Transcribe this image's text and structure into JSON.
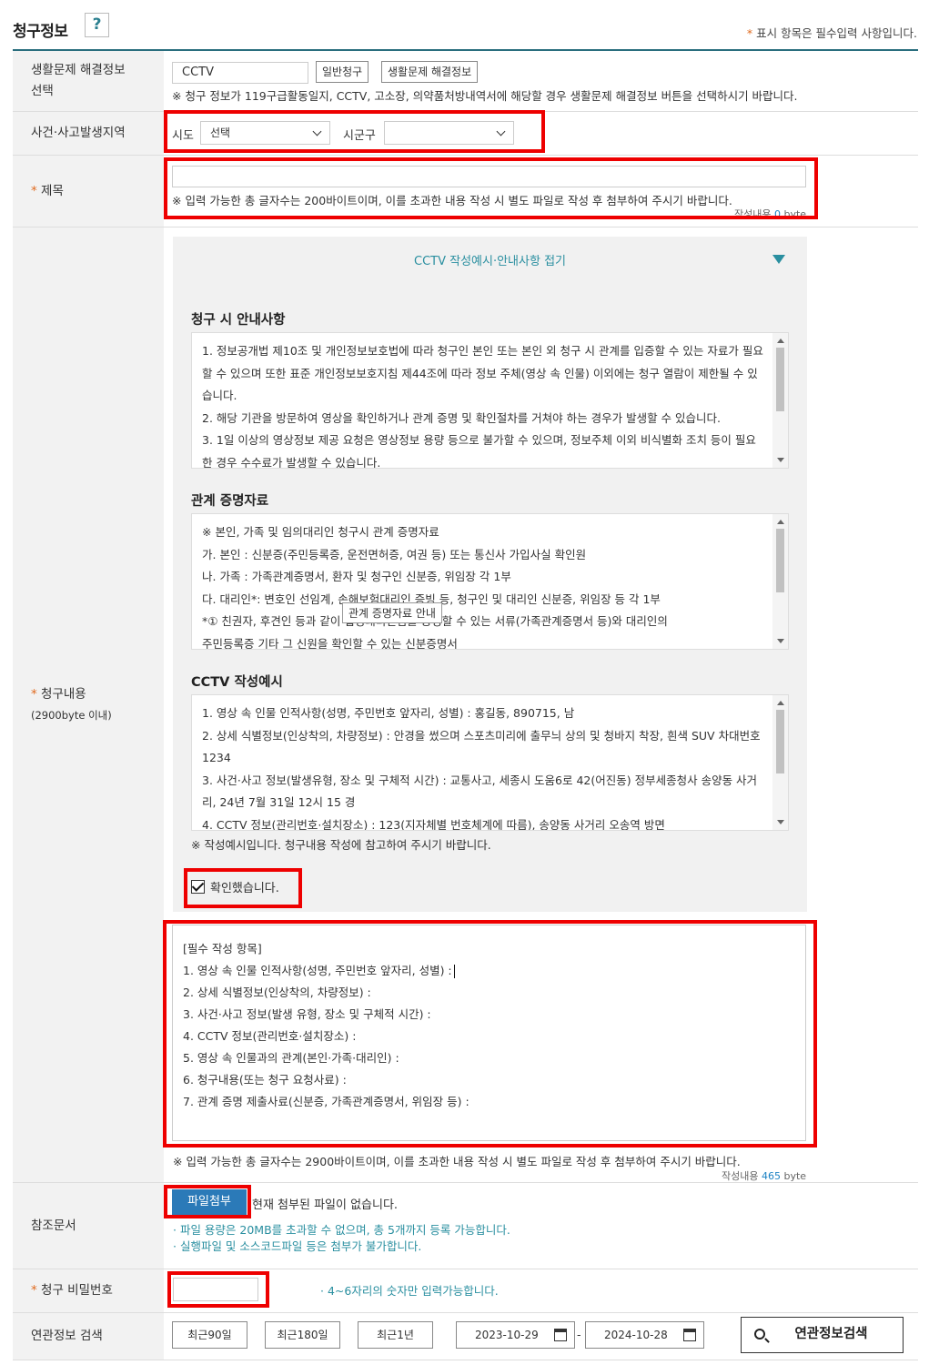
{
  "header": {
    "title": "청구정보",
    "help_label": "?",
    "required_note_star": "*",
    "required_note": " 표시 항목은 필수입력 사항입니다."
  },
  "solution_row": {
    "label_line1": "생활문제 해결정보",
    "label_line2": "선택",
    "value": "CCTV",
    "btn_general": "일반청구",
    "btn_solution": "생활문제 해결정보",
    "note": "※ 청구 정보가 119구급활동일지, CCTV, 고소장, 의약품처방내역서에 해당할 경우 생활문제 해결정보 버튼을 선택하시기 바랍니다."
  },
  "region_row": {
    "label": "사건·사고발생지역",
    "sido_label": "시도",
    "sido_value": "선택",
    "sigungu_label": "시군구",
    "sigungu_value": ""
  },
  "title_row": {
    "star": "*",
    "label": "제목",
    "value": "",
    "note": "※ 입력 가능한 총 글자수는 200바이트이며, 이를 초과한 내용 작성 시 별도 파일로 작성 후 첨부하여 주시기 바랍니다.",
    "count_prefix": "작성내용",
    "count": "0",
    "count_unit": "byte"
  },
  "content_row": {
    "star": "*",
    "label_line1": "청구내용",
    "label_line2": "(2900byte 이내)",
    "guide_toggle": "CCTV 작성예시·안내사항 접기",
    "notice_title": "청구 시 안내사항",
    "notice_lines": [
      "1. 정보공개법 제10조 및 개인정보보호법에 따라 청구인 본인 또는 본인 외 청구 시 관계를 입증할 수 있는 자료가 필요",
      "할 수 있으며 또한 표준 개인정보보호지침 제44조에 따라 정보 주체(영상 속 인물) 이외에는 청구 열람이 제한될 수 있",
      "습니다.",
      "2. 해당 기관을 방문하여 영상을 확인하거나 관계 증명 및 확인절차를 거쳐야 하는 경우가 발생할 수 있습니다.",
      "3. 1일 이상의 영상정보 제공 요청은 영상정보 용량 등으로 불가할 수 있으며, 정보주체 이외 비식별화 조치 등이 필요",
      "한 경우 수수료가 발생할 수 있습니다."
    ],
    "proof_title": "관계 증명자료",
    "proof_lines": [
      "※ 본인, 가족 및 임의대리인 청구시 관계 증명자료",
      "가. 본인 : 신분증(주민등록증, 운전면허증, 여권 등) 또는 통신사 가입사실 확인원",
      "나. 가족 : 가족관계증명서, 환자 및 청구인 신분증, 위임장 각 1부",
      "다. 대리인*: 변호인 선임계, 손해보험대리인 증빙 등, 청구인 및 대리인 신분증, 위임장 등 각 1부",
      "*① 친권자, 후견인 등과 같이 법정대리인임을 증명할 수 있는 서류(가족관계증명서 등)와 대리인의",
      "주민등록증 기타 그 신원을 확인할 수 있는 신분증명서"
    ],
    "proof_tooltip": "관계 증명자료 안내",
    "example_title": "CCTV 작성예시",
    "example_lines": [
      "1. 영상 속 인물 인적사항(성명, 주민번호 앞자리, 성별) : 홍길동, 890715, 남",
      "2. 상세 식별정보(인상착의, 차량정보) : 안경을 썼으며 스포츠미리에 출무늬 상의 및 청바지 착장, 흰색 SUV 차대번호",
      "1234",
      "3. 사건·사고 정보(발생유형, 장소 및 구체적 시간) : 교통사고, 세종시 도움6로 42(어진동) 정부세종청사 송양동 사거",
      "리, 24년 7월 31일 12시 15 경",
      "4. CCTV 정보(관리번호·설치장소) : 123(지자체별 번호체계에 따름), 송양동 사거리 오송역 방면"
    ],
    "example_note": "※ 작성예시입니다. 청구내용 작성에 참고하여 주시기 바랍니다.",
    "confirm_label": "확인했습니다.",
    "textarea_lines": [
      "[필수 작성 항목]",
      "1. 영상 속 인물 인적사항(성명, 주민번호 앞자리, 성별) :",
      "2. 상세 식별정보(인상착의, 차량정보) :",
      "3. 사건·사고 정보(발생 유형, 장소 및 구체적 시간) :",
      "4. CCTV 정보(관리번호·설치장소) :",
      "5. 영상 속 인물과의 관계(본인·가족·대리인) :",
      "6. 청구내용(또는 청구 요청사료) :",
      "7. 관계 증명 제출사료(신분증, 가족관계증명서, 위임장 등) :"
    ],
    "note": "※ 입력 가능한 총 글자수는 2900바이트이며, 이를 초과한 내용 작성 시 별도 파일로 작성 후 첨부하여 주시기 바랍니다.",
    "count_prefix": "작성내용",
    "count": "465",
    "count_unit": "byte"
  },
  "file_row": {
    "label": "참조문서",
    "btn": "파일첨부",
    "status": "현재 첨부된 파일이 없습니다.",
    "note1": "· 파일 용량은 20MB를 초과할 수 없으며, 총 5개까지 등록 가능합니다.",
    "note2": "· 실행파일 및 소스코드파일 등은 첨부가 불가합니다."
  },
  "password_row": {
    "star": "*",
    "label": "청구 비밀번호",
    "value": "",
    "note": "· 4~6자리의 숫자만 입력가능합니다."
  },
  "related_row": {
    "label": "연관정보 검색",
    "btn_90": "최근90일",
    "btn_180": "최근180일",
    "btn_1y": "최근1년",
    "date_from": "2023-10-29",
    "date_sep": "-",
    "date_to": "2024-10-28",
    "search_btn": "연관정보검색"
  },
  "colors": {
    "accent": "#2a8fa0",
    "highlight": "#e00000",
    "file_button": "#2b7ab8",
    "required_star": "#e06a1e"
  }
}
